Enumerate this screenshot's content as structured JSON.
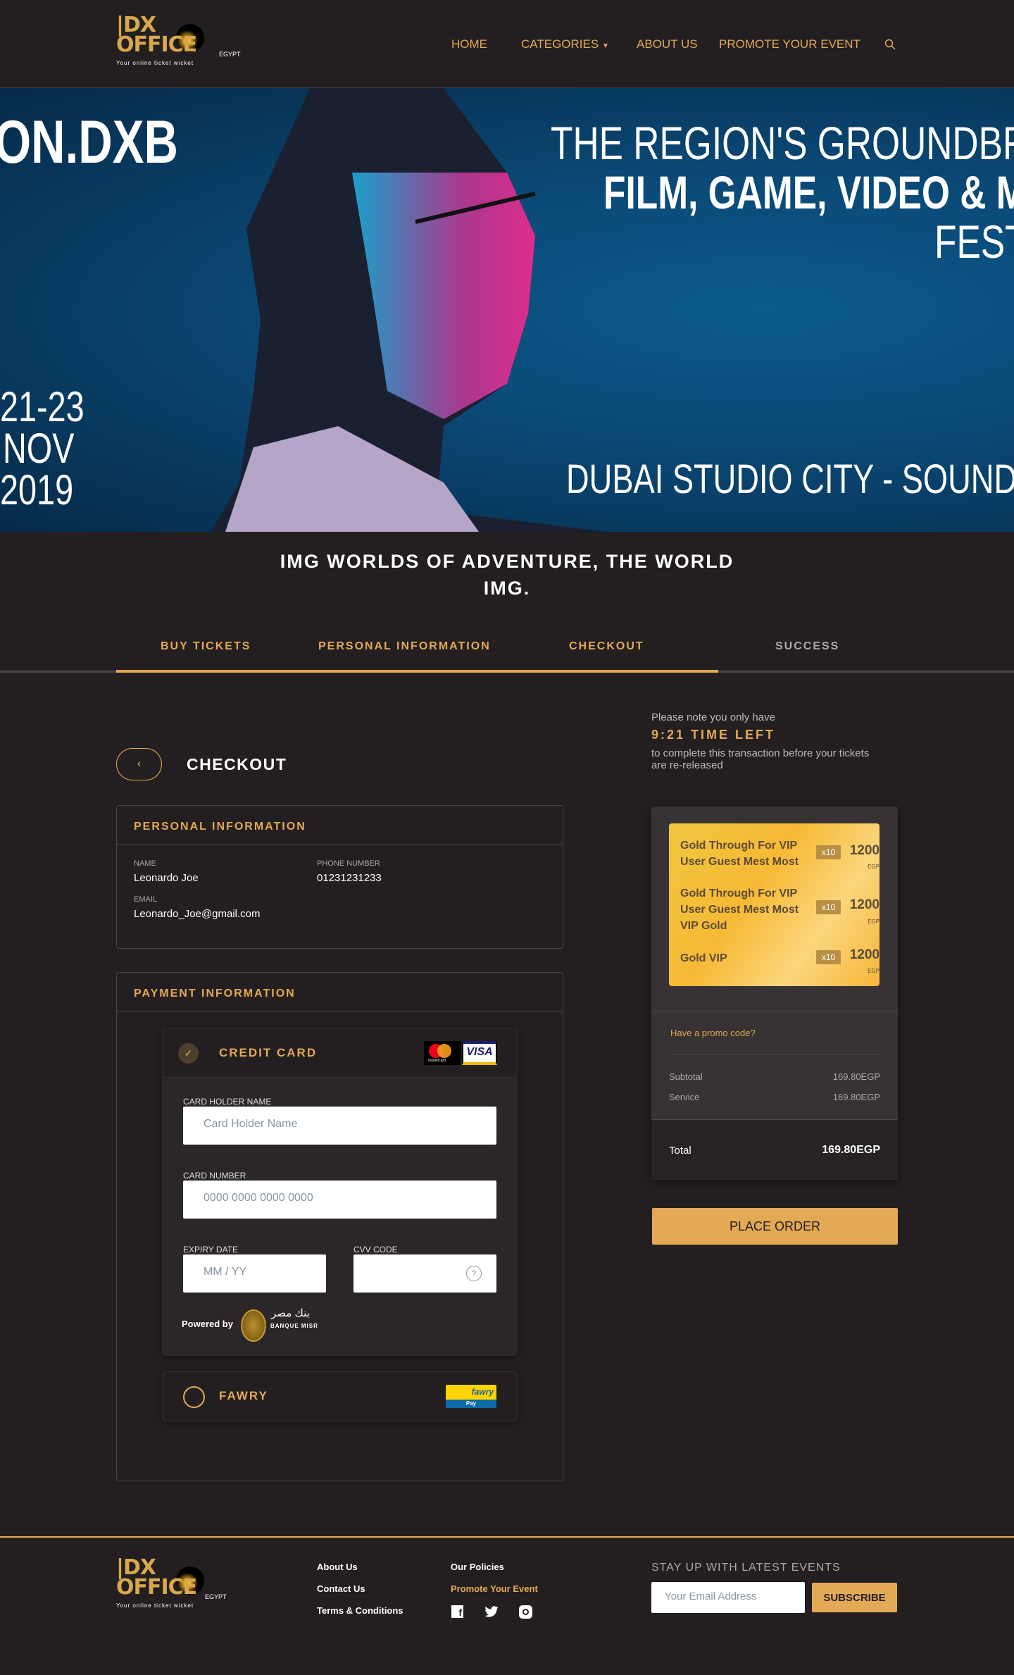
{
  "brand": {
    "logo_text": "BX OFFICE",
    "logo_suffix": "EGYPT",
    "tagline": "Your online ticket wicket"
  },
  "nav": {
    "items": [
      "HOME",
      "CATEGORIES",
      "ABOUT US",
      "PROMOTE YOUR EVENT"
    ],
    "search_icon": "search-icon"
  },
  "hero": {
    "name": "ON.DXB",
    "headline1": "THE REGION'S GROUNDBREAK",
    "headline2": "FILM, GAME, VIDEO & MU",
    "headline3": "FEST",
    "date1": "21-23",
    "date2": "NOV",
    "date3": "2019",
    "venue": "DUBAI STUDIO CITY - SOUND STA"
  },
  "event": {
    "title_line1": "IMG WORLDS OF ADVENTURE, THE WORLD",
    "title_line2": "IMG."
  },
  "steps": {
    "items": [
      "BUY TICKETS",
      "PERSONAL INFORMATION",
      "CHECKOUT",
      "SUCCESS"
    ],
    "completed": 3,
    "total": 4
  },
  "checkout": {
    "title": "CHECKOUT"
  },
  "personal": {
    "title": "PERSONAL INFORMATION",
    "name_label": "NAME",
    "name": "Leonardo Joe",
    "phone_label": "PHONE NUMBER",
    "phone": "01231231233",
    "email_label": "EMAIL",
    "email": "Leonardo_Joe@gmail.com"
  },
  "payment": {
    "title": "PAYMENT INFORMATION",
    "credit": {
      "label": "CREDIT CARD",
      "selected": true,
      "holder_label": "CARD HOLDER NAME",
      "holder_placeholder": "Card Holder Name",
      "number_label": "CARD NUMBER",
      "number_placeholder": "0000 0000 0000 0000",
      "expiry_label": "EXPIRY DATE",
      "expiry_placeholder": "MM / YY",
      "cvv_label": "CVV CODE",
      "powered_by": "Powered by",
      "bank": "BANQUE MISR",
      "bank_ar": "بنك مصر",
      "mastercard": "mastercard",
      "visa": "VISA"
    },
    "fawry": {
      "label": "FAWRY",
      "selected": false,
      "logo": "fawry",
      "logo_sub": "Pay"
    }
  },
  "timer": {
    "note": "Please note you only have",
    "time": "9:21 TIME LEFT",
    "note2": "to complete this transaction before your tickets are re-released"
  },
  "summary": {
    "tickets": [
      {
        "name": "Gold Through For VIP User Guest Mest Most",
        "qty": "x10",
        "price": "1200",
        "currency": "EGP"
      },
      {
        "name": "Gold Through For VIP User Guest Mest Most VIP Gold",
        "qty": "x10",
        "price": "1200",
        "currency": "EGP"
      },
      {
        "name": "Gold VIP",
        "qty": "x10",
        "price": "1200",
        "currency": "EGP"
      }
    ],
    "promo": "Have a promo code?",
    "subtotal_label": "Subtotal",
    "subtotal": "169.80EGP",
    "service_label": "Service",
    "service": "169.80EGP",
    "total_label": "Total",
    "total": "169.80EGP",
    "place_order": "PLACE ORDER"
  },
  "footer": {
    "links": [
      "About Us",
      "Contact Us",
      "Terms & Conditions"
    ],
    "policies": "Our Policies",
    "promote": "Promote Your Event",
    "newsletter_title": "STAY UP WITH LATEST EVENTS",
    "email_placeholder": "Your Email Address",
    "subscribe": "SUBSCRIBE",
    "social": [
      "facebook-icon",
      "twitter-icon",
      "instagram-icon"
    ]
  },
  "colors": {
    "accent": "#e3a955",
    "background": "#231f20",
    "card": "#373233"
  }
}
